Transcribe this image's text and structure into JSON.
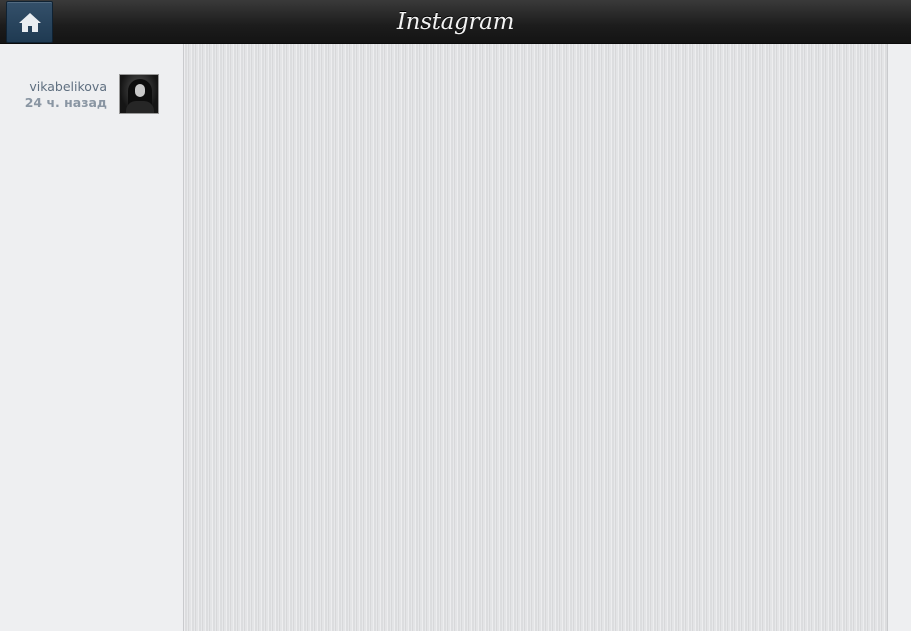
{
  "header": {
    "logo_text": "Instagram",
    "home_icon": "home-icon",
    "bar_color": "#1c1c1c",
    "home_button_color": "#2a4560"
  },
  "sidebar": {
    "posts": [
      {
        "username": "vikabelikova",
        "time_ago": "24 ч. назад",
        "avatar": "user-avatar"
      }
    ]
  },
  "main": {
    "background_color": "#e3e4e6"
  }
}
